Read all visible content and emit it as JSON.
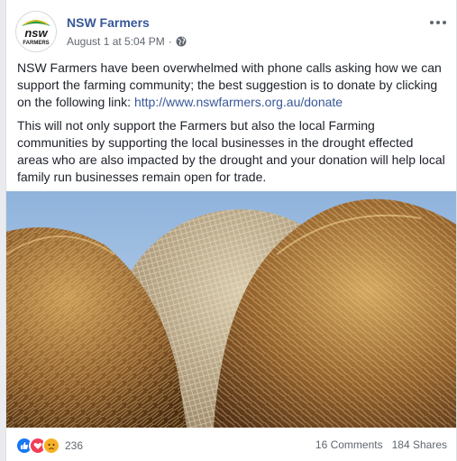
{
  "post": {
    "page_name": "NSW Farmers",
    "timestamp": "August 1 at 5:04 PM",
    "separator": "·",
    "audience_icon": "globe-icon",
    "more_icon": "ellipsis-icon",
    "avatar": {
      "line1": "nsw",
      "line2": "FARMERS",
      "colors": {
        "green": "#2e9a3c",
        "dark": "#1b1b1b"
      }
    },
    "paragraph1_text": "NSW Farmers have been overwhelmed with phone calls asking how we can support the farming community; the best suggestion is to donate by clicking on the following link: ",
    "paragraph1_link": "http://www.nswfarmers.org.au/donate",
    "paragraph2": "This will not only support the Farmers but also the local Farming communities by supporting the local businesses in the drought effected areas who are also impacted by the drought and your donation will help local family run businesses remain open for trade."
  },
  "photo": {
    "subject": "hay bales under a blue sky"
  },
  "footer": {
    "reaction_icons": [
      "like-icon",
      "love-icon",
      "sad-icon"
    ],
    "reaction_count": "236",
    "comments": "16 Comments",
    "shares": "184 Shares"
  },
  "colors": {
    "link": "#385898",
    "text": "#1d2129",
    "meta": "#616770",
    "like": "#1877f2",
    "love": "#f33e58",
    "sad": "#f7b125"
  }
}
